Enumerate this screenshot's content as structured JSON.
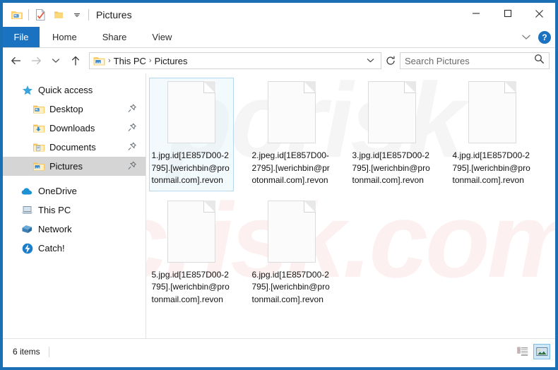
{
  "window": {
    "title": "Pictures",
    "border_color": "#1b6fb5",
    "quick_access_toolbar": [
      {
        "name": "properties-icon",
        "label": "Properties"
      },
      {
        "name": "new-folder-icon",
        "label": "New folder"
      },
      {
        "name": "customize-qat-icon",
        "label": "Customize Quick Access Toolbar"
      }
    ],
    "controls": {
      "minimize": "—",
      "maximize": "□",
      "close": "✕"
    }
  },
  "ribbon": {
    "file_tab": "File",
    "tabs": [
      "Home",
      "Share",
      "View"
    ],
    "collapse_icon": "∨",
    "help_label": "?",
    "file_tab_color": "#1b72c0"
  },
  "address": {
    "back_icon": "←",
    "forward_icon": "→",
    "recent_icon": "∨",
    "up_icon": "↑",
    "breadcrumb": [
      "This PC",
      "Pictures"
    ],
    "breadcrumb_sep": "›",
    "dropdown_icon": "∨",
    "refresh_icon": "↻",
    "search_placeholder": "Search Pictures",
    "search_value": "",
    "search_icon": "search-icon"
  },
  "sidebar": {
    "items": [
      {
        "label": "Quick access",
        "icon": "star-icon",
        "child": false,
        "pinned": false,
        "selected": false
      },
      {
        "label": "Desktop",
        "icon": "folder-desktop-icon",
        "child": true,
        "pinned": true,
        "selected": false
      },
      {
        "label": "Downloads",
        "icon": "folder-downloads-icon",
        "child": true,
        "pinned": true,
        "selected": false
      },
      {
        "label": "Documents",
        "icon": "folder-documents-icon",
        "child": true,
        "pinned": true,
        "selected": false
      },
      {
        "label": "Pictures",
        "icon": "folder-pictures-icon",
        "child": true,
        "pinned": true,
        "selected": true
      },
      {
        "label": "OneDrive",
        "icon": "cloud-icon",
        "child": false,
        "pinned": false,
        "selected": false
      },
      {
        "label": "This PC",
        "icon": "computer-icon",
        "child": false,
        "pinned": false,
        "selected": false
      },
      {
        "label": "Network",
        "icon": "network-icon",
        "child": false,
        "pinned": false,
        "selected": false
      },
      {
        "label": "Catch!",
        "icon": "catch-icon",
        "child": false,
        "pinned": false,
        "selected": false
      }
    ]
  },
  "content": {
    "watermark_text": "pcrisk.com",
    "watermark_text2": "pcrisk",
    "files": [
      {
        "name": "1.jpg.id[1E857D00-2795].[werichbin@protonmail.com].revon",
        "icon": "blank-document-icon",
        "selected": true
      },
      {
        "name": "2.jpeg.id[1E857D00-2795].[werichbin@protonmail.com].revon",
        "icon": "blank-document-icon",
        "selected": false
      },
      {
        "name": "3.jpg.id[1E857D00-2795].[werichbin@protonmail.com].revon",
        "icon": "blank-document-icon",
        "selected": false
      },
      {
        "name": "4.jpg.id[1E857D00-2795].[werichbin@protonmail.com].revon",
        "icon": "blank-document-icon",
        "selected": false
      },
      {
        "name": "5.jpg.id[1E857D00-2795].[werichbin@protonmail.com].revon",
        "icon": "blank-document-icon",
        "selected": false
      },
      {
        "name": "6.jpg.id[1E857D00-2795].[werichbin@protonmail.com].revon",
        "icon": "blank-document-icon",
        "selected": false
      }
    ]
  },
  "statusbar": {
    "item_count": "6 items",
    "views": [
      {
        "name": "details-view-button",
        "active": false
      },
      {
        "name": "large-icons-view-button",
        "active": true
      }
    ]
  }
}
